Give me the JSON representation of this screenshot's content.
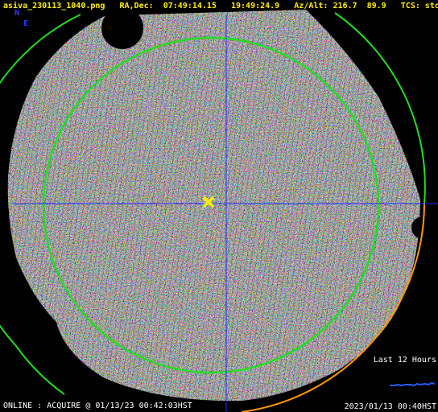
{
  "header": {
    "filename": "asiva_230113_1040.png",
    "radec_label": "RA,Dec:",
    "ra": "07:49:14.15",
    "dec": "19:49:24.9",
    "azalt_label": "Az/Alt:",
    "az": "216.7",
    "alt": "89.9",
    "tcs_label": "TCS:",
    "tcs_state": "stop"
  },
  "compass": {
    "north": "N",
    "east": "E"
  },
  "trend": {
    "label": "Last 12 Hours"
  },
  "footer": {
    "status": "ONLINE : ACQUIRE @ 01/13/23 00:42:03HST",
    "datetime": "2023/01/13 00:40HST"
  },
  "colors": {
    "ring": "#22dd22",
    "crosshair": "#1c2cff",
    "marker": "#ffee00",
    "arc": "#ff9900",
    "text": "#ffee00"
  }
}
